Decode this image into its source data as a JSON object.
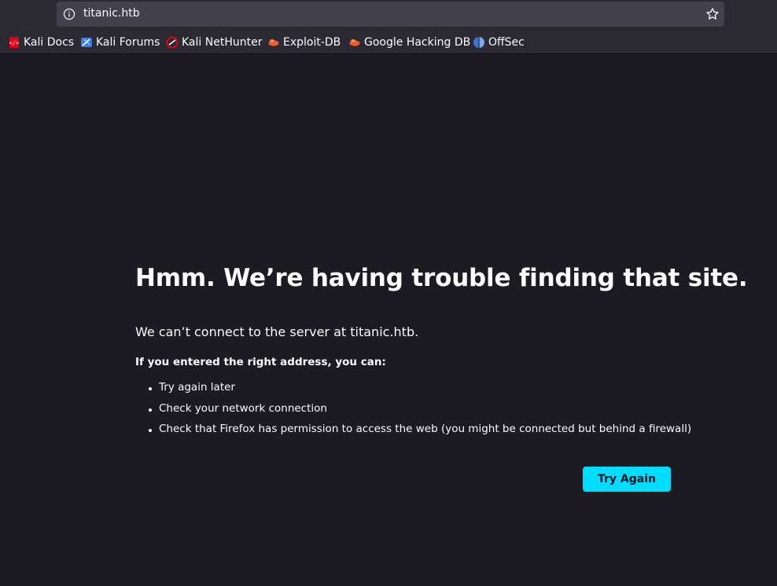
{
  "browser": {
    "url": "titanic.htb",
    "bookmarks": [
      {
        "label": "Kali Docs",
        "icon": "kali-docs-icon",
        "color": "#e2001a"
      },
      {
        "label": "Kali Forums",
        "icon": "kali-forums-icon",
        "color": "#3d7fe0"
      },
      {
        "label": "Kali NetHunter",
        "icon": "kali-nethunter-icon",
        "color": "#e2001a"
      },
      {
        "label": "Exploit-DB",
        "icon": "exploit-db-icon",
        "color": "#ef5b2b"
      },
      {
        "label": "Google Hacking DB",
        "icon": "google-hacking-db-icon",
        "color": "#ef5b2b"
      },
      {
        "label": "OffSec",
        "icon": "offsec-icon",
        "color": "#4a7bd6"
      }
    ]
  },
  "error_page": {
    "title": "Hmm. We’re having trouble finding that site.",
    "description": "We can’t connect to the server at titanic.htb.",
    "subheading": "If you entered the right address, you can:",
    "suggestions": [
      "Try again later",
      "Check your network connection",
      "Check that Firefox has permission to access the web (you might be connected but behind a firewall)"
    ],
    "button_label": "Try Again"
  },
  "colors": {
    "page_background": "#1c1b22",
    "toolbar_background": "#2b2a33",
    "accent": "#00ddff"
  }
}
